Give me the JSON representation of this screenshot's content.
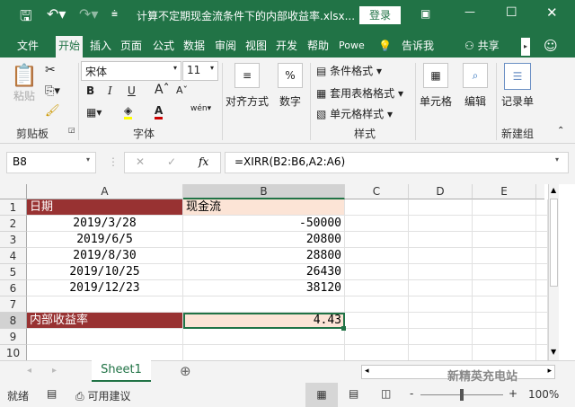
{
  "title": {
    "filename": "计算不定期现金流条件下的内部收益率.xlsx...",
    "login": "登录"
  },
  "tabs": [
    "文件",
    "开始",
    "插入",
    "页面",
    "公式",
    "数据",
    "审阅",
    "视图",
    "开发",
    "帮助",
    "Powe",
    "告诉我",
    "共享"
  ],
  "ribbon": {
    "paste": "粘贴",
    "clipboard": "剪贴板",
    "font_name": "宋体",
    "font_size": "11",
    "bold": "B",
    "italic": "I",
    "underline": "U",
    "font_group": "字体",
    "align": "对齐方式",
    "number": "数字",
    "percent": "%",
    "cond_format": "条件格式",
    "table_format": "套用表格格式",
    "cell_style": "单元格样式",
    "styles_group": "样式",
    "cells": "单元格",
    "edit": "编辑",
    "record": "记录单",
    "new_group": "新建组"
  },
  "formula_bar": {
    "name_box": "B8",
    "formula": "=XIRR(B2:B6,A2:A6)",
    "fx": "fx"
  },
  "columns": [
    "A",
    "B",
    "C",
    "D",
    "E"
  ],
  "rows": [
    "1",
    "2",
    "3",
    "4",
    "5",
    "6",
    "7",
    "8",
    "9",
    "10"
  ],
  "cells": {
    "A1": "日期",
    "B1": "现金流",
    "A2": "2019/3/28",
    "B2": "-50000",
    "A3": "2019/6/5",
    "B3": "20800",
    "A4": "2019/8/30",
    "B4": "28800",
    "A5": "2019/10/25",
    "B5": "26430",
    "A6": "2019/12/23",
    "B6": "38120",
    "A8": "内部收益率",
    "B8": "4.43"
  },
  "sheet_tab": "Sheet1",
  "status": {
    "ready": "就绪",
    "accessibility": "可用建议",
    "zoom": "100%"
  },
  "watermark": "新精英充电站",
  "colors": {
    "excel_green": "#217346",
    "header_fill": "#983232",
    "peach_fill": "#fce4d6"
  }
}
